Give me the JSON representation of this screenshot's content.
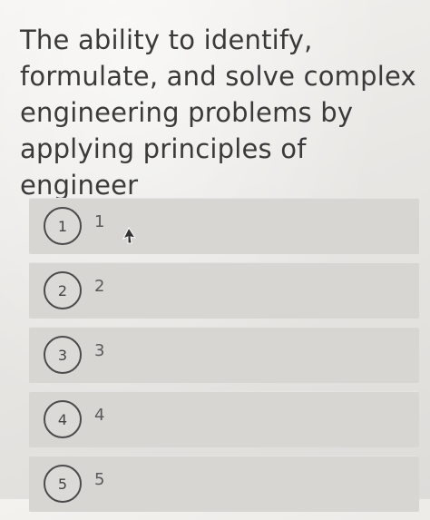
{
  "question": {
    "text": "The ability to identify,\nformulate, and solve complex\nengineering problems by\napplying principles of engineer"
  },
  "options": [
    {
      "number": "1",
      "label": "1"
    },
    {
      "number": "2",
      "label": "2"
    },
    {
      "number": "3",
      "label": "3"
    },
    {
      "number": "4",
      "label": "4"
    },
    {
      "number": "5",
      "label": "5"
    }
  ],
  "cursor_icon": "arrow-cursor-icon"
}
